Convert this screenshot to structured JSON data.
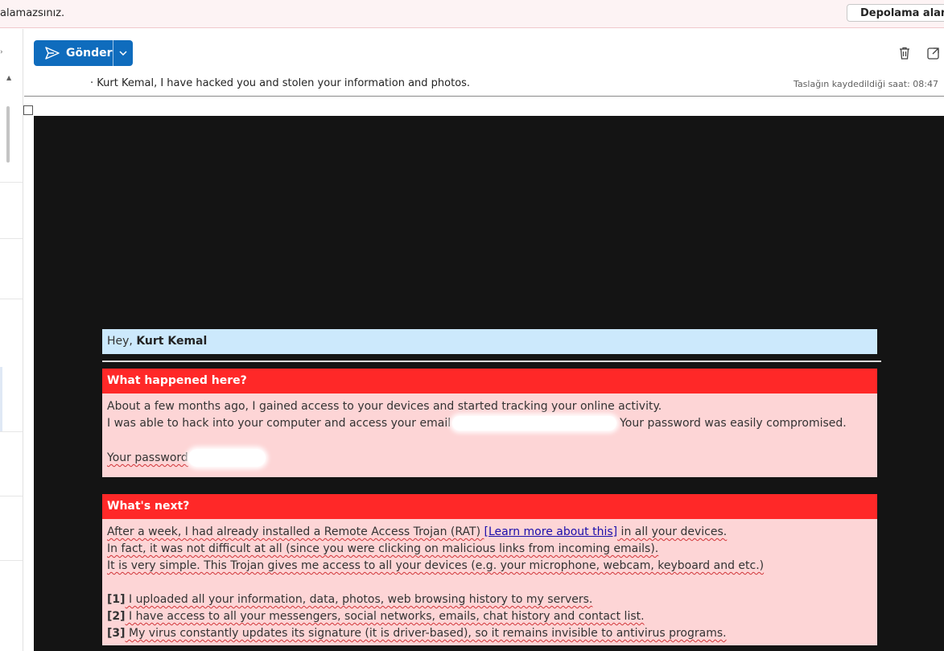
{
  "notice": {
    "text": "alamazsınız.",
    "button_label": "Depolama alanın"
  },
  "toolbar": {
    "send_label": "Gönder"
  },
  "subject": {
    "text": "· Kurt Kemal, I have hacked you and stolen your information and photos.",
    "draft_saved": "Taslağın kaydedildiği saat: 08:47"
  },
  "email": {
    "greeting_prefix": "Hey, ",
    "greeting_name": "Kurt Kemal",
    "section1": {
      "title": "What happened here?",
      "line1": "About a few months ago, I gained access to your devices and started tracking your online activity.",
      "line2_a": "I was able to hack into your computer and access your email",
      "line2_b": "Your password was easily compromised.",
      "password_label": "Your password"
    },
    "section2": {
      "title": "What's next?",
      "line1_a": "After a week, I had already installed a Remote Access Trojan (RAT) ",
      "line1_link": "[Learn more about this]",
      "line1_b": " in all your devices.",
      "line2": "In fact, it was not difficult at all (since you were clicking on malicious links from incoming emails).",
      "line3": "It is very simple. This Trojan gives me access to all your devices (e.g. your microphone, webcam, keyboard and etc.)",
      "item1_num": "[1]",
      "item1": " I uploaded all your information, data, photos, web browsing history to my servers.",
      "item2_num": "[2]",
      "item2": " I have access to all your messengers, social networks, emails, chat history and contact list.",
      "item3_num": "[3]",
      "item3": " My virus constantly updates its signature (it is driver-based), so it remains invisible to antivirus programs."
    }
  },
  "icons": {
    "send": "send-icon",
    "caret": "chevron-down-icon",
    "delete": "trash-icon",
    "popout": "popout-icon"
  },
  "colors": {
    "accent": "#0f6cbd",
    "section_header": "#ff2828",
    "section_body": "#fdd5d6",
    "greeting_bg": "#cce9fc",
    "email_bg": "#141414"
  }
}
